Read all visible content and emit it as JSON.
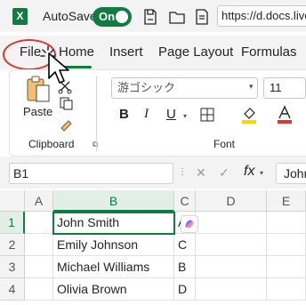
{
  "titlebar": {
    "app_icon": "excel-icon",
    "autosave_label": "AutoSave",
    "toggle_text": "On",
    "url": "https://d.docs.live.net"
  },
  "tabs": {
    "file": "File",
    "home": "Home",
    "insert": "Insert",
    "page_layout": "Page Layout",
    "formulas": "Formulas"
  },
  "ribbon": {
    "paste_label": "Paste",
    "clipboard_label": "Clipboard",
    "font_label": "Font",
    "font_name": "游ゴシック",
    "font_size": "11",
    "bold": "B",
    "italic": "I",
    "underline": "U"
  },
  "formula_bar": {
    "name_box": "B1",
    "fx": "fx",
    "content": "John"
  },
  "grid": {
    "columns": [
      "A",
      "B",
      "C",
      "D",
      "E"
    ],
    "rows": [
      {
        "num": "1",
        "b": "John Smith",
        "c": "A"
      },
      {
        "num": "2",
        "b": "Emily Johnson",
        "c": "C"
      },
      {
        "num": "3",
        "b": "Michael Williams",
        "c": "B"
      },
      {
        "num": "4",
        "b": "Olivia Brown",
        "c": "D"
      }
    ]
  },
  "colors": {
    "accent": "#107c41",
    "annotation": "#e0342f"
  }
}
